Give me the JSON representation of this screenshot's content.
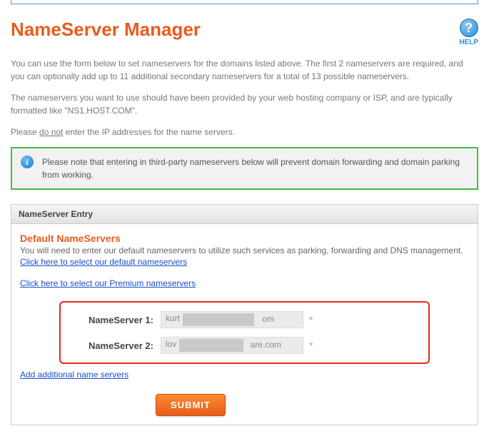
{
  "page_title": "NameServer Manager",
  "help_label": "HELP",
  "intro": {
    "p1": "You can use the form below to set nameservers for the domains listed above. The first 2 nameservers are required, and you can optionally add up to 11 additional secondary nameservers for a total of 13 possible nameservers.",
    "p2a": "The nameservers you want to use should have been provided by your web hosting company or ISP, and are typically formatted like \"NS1.HOST.COM\".",
    "p3_pre": "Please ",
    "p3_u": "do not",
    "p3_post": " enter the IP addresses for the name servers."
  },
  "notice": "Please note that entering in third-party nameservers below will prevent domain forwarding and domain parking from working.",
  "section_header": "NameServer Entry",
  "default": {
    "title": "Default NameServers",
    "desc": "You will need to enter our default nameservers to utilize such services as parking, forwarding and DNS management.",
    "link_default": "Click here to select our default nameservers",
    "link_premium": "Click here to select our Premium nameservers"
  },
  "ns": {
    "label1": "NameServer 1:",
    "label2": "NameServer 2:",
    "value1_pre": "kurt",
    "value1_post": "om",
    "value2_pre": "lov",
    "value2_post": "are.com",
    "required_marker": "*"
  },
  "add_link": "Add additional name servers",
  "submit_label": "SUBMIT"
}
